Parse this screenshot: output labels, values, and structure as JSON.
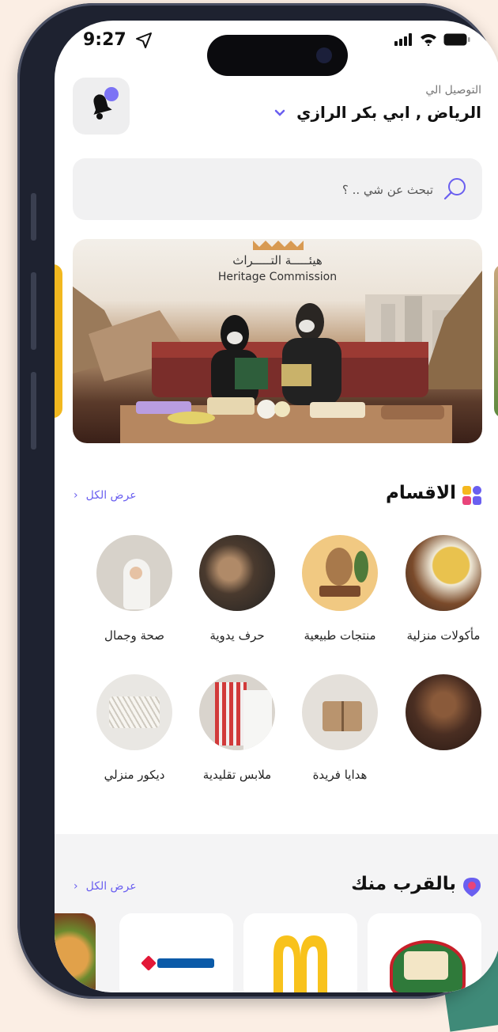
{
  "status": {
    "time": "9:27"
  },
  "header": {
    "deliver_label": "التوصيل الي",
    "address": "الرياض , ابي بكر الرازي"
  },
  "search": {
    "placeholder": "تبحث عن شي .. ؟"
  },
  "banner": {
    "title_ar": "هيئـــــة التـــــراث",
    "title_en": "Heritage Commission"
  },
  "categories": {
    "title": "الاقسام",
    "see_all": "عرض الكل",
    "items": [
      {
        "label": "مأكولات منزلية"
      },
      {
        "label": "منتجات طبيعية"
      },
      {
        "label": "حرف يدوية"
      },
      {
        "label": "صحة وجمال"
      },
      {
        "label": ""
      },
      {
        "label": "هدايا فريدة"
      },
      {
        "label": "ملابس تقليدية"
      },
      {
        "label": "ديكور منزلي"
      }
    ]
  },
  "nearby": {
    "title": "بالقرب منك",
    "see_all": "عرض الكل",
    "stores": [
      {
        "name": "الطازج"
      },
      {
        "name": "ماكدونالدز"
      },
      {
        "name": "دومينوز"
      }
    ]
  },
  "colors": {
    "accent": "#6a5ff0",
    "banner_side": "#f2b81f"
  }
}
